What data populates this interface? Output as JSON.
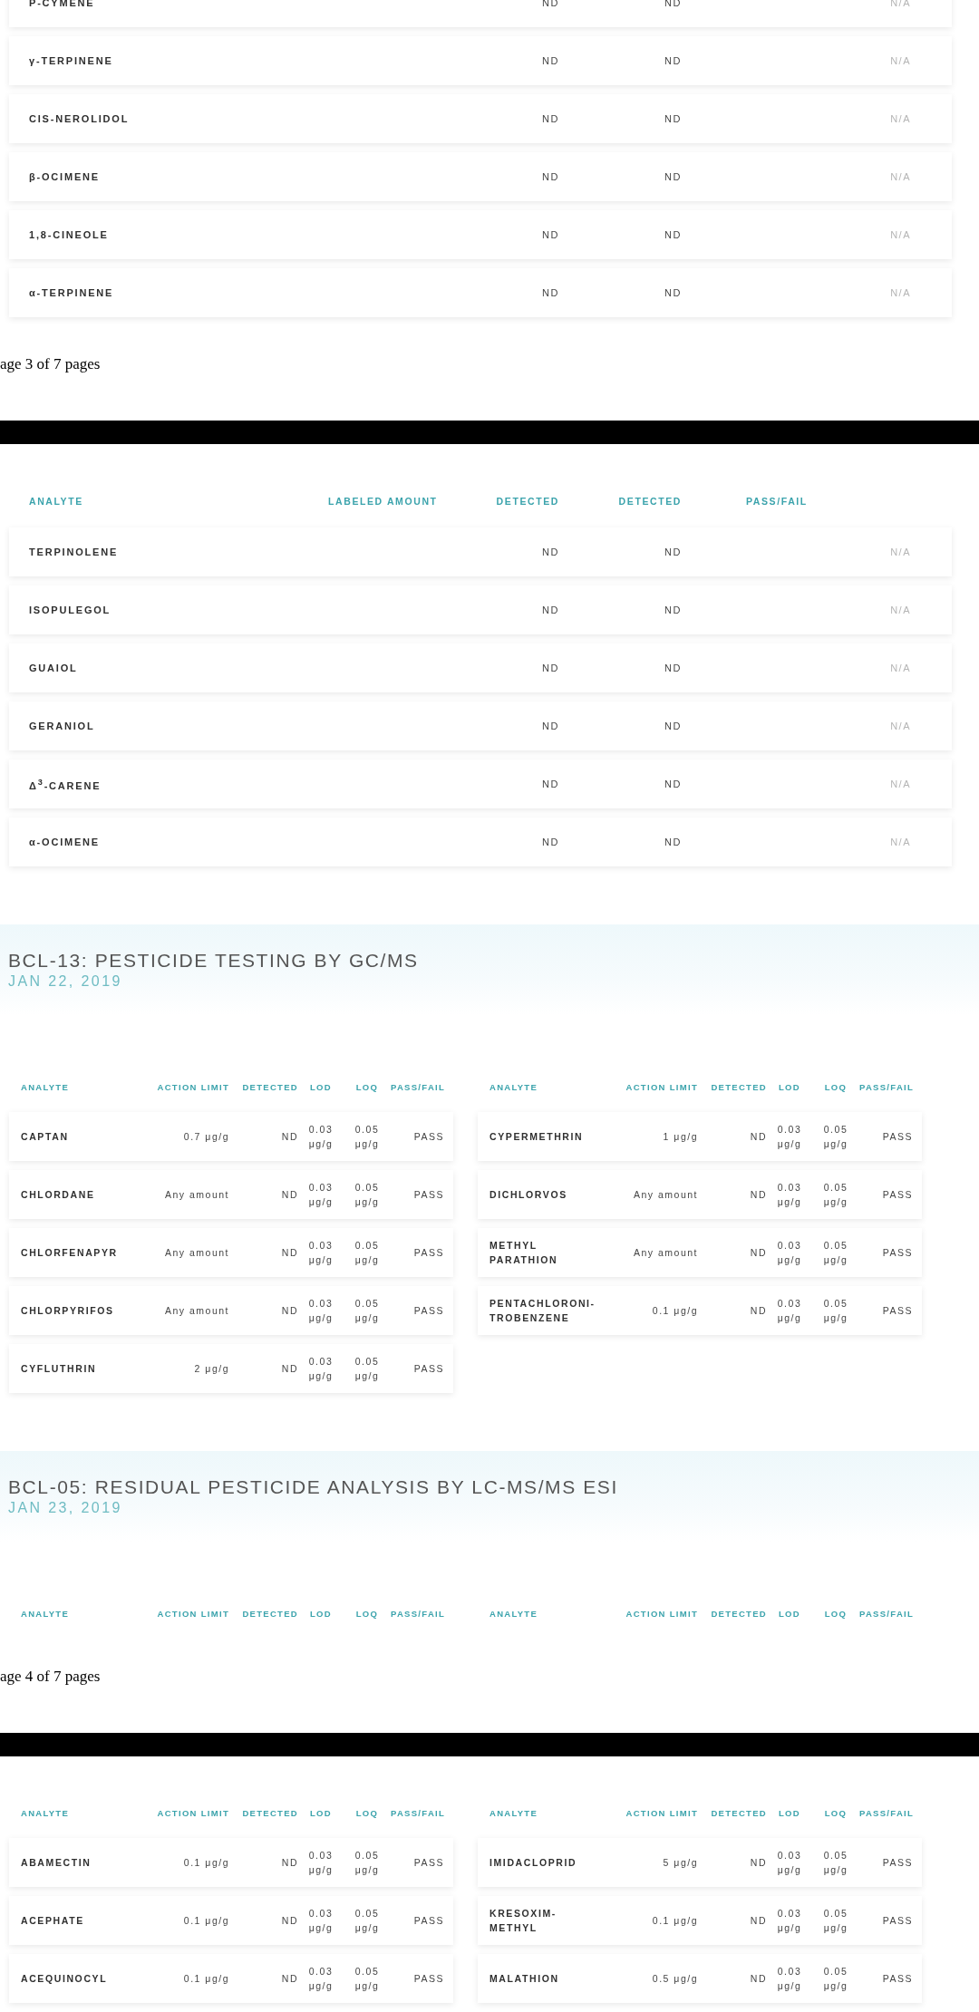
{
  "blocks": [
    {
      "kind": "terpene_table",
      "rows": [
        {
          "analyte": "P-CYMENE",
          "detected_1": "ND",
          "detected_2": "ND",
          "result": "N/A"
        },
        {
          "analyte": "γ-TERPINENE",
          "detected_1": "ND",
          "detected_2": "ND",
          "result": "N/A"
        },
        {
          "analyte": "CIS-NEROLIDOL",
          "detected_1": "ND",
          "detected_2": "ND",
          "result": "N/A"
        },
        {
          "analyte": "β-OCIMENE",
          "detected_1": "ND",
          "detected_2": "ND",
          "result": "N/A"
        },
        {
          "analyte": "1,8-CINEOLE",
          "detected_1": "ND",
          "detected_2": "ND",
          "result": "N/A"
        },
        {
          "analyte": "α-TERPINENE",
          "detected_1": "ND",
          "detected_2": "ND",
          "result": "N/A"
        }
      ]
    },
    {
      "kind": "page_footer",
      "text": "age 3 of 7 pages"
    },
    {
      "kind": "page_break"
    },
    {
      "kind": "terpene_table",
      "columns": [
        "ANALYTE",
        "LABELED AMOUNT",
        "DETECTED",
        "DETECTED",
        "PASS/FAIL"
      ],
      "rows": [
        {
          "analyte": "TERPINOLENE",
          "detected_1": "ND",
          "detected_2": "ND",
          "result": "N/A"
        },
        {
          "analyte": "ISOPULEGOL",
          "detected_1": "ND",
          "detected_2": "ND",
          "result": "N/A"
        },
        {
          "analyte": "GUAIOL",
          "detected_1": "ND",
          "detected_2": "ND",
          "result": "N/A"
        },
        {
          "analyte": "GERANIOL",
          "detected_1": "ND",
          "detected_2": "ND",
          "result": "N/A"
        },
        {
          "analyte": "Δ$^{3}$-CARENE",
          "detected_1": "ND",
          "detected_2": "ND",
          "result": "N/A"
        },
        {
          "analyte": "α-OCIMENE",
          "detected_1": "ND",
          "detected_2": "ND",
          "result": "N/A"
        }
      ]
    },
    {
      "kind": "section_heading",
      "title": "BCL-13: PESTICIDE TESTING BY GC/MS",
      "date": "JAN 22, 2019"
    },
    {
      "kind": "pesticide_tables",
      "tables": [
        {
          "columns": [
            "ANALYTE",
            "ACTION LIMIT",
            "DETECTED",
            "LOD",
            "LOQ",
            "PASS/FAIL"
          ],
          "rows": [
            {
              "analyte": "CAPTAN",
              "action_limit": "0.7 μg/g",
              "detected": "ND",
              "lod": "0.03 μg/g",
              "loq": "0.05 μg/g",
              "result": "PASS"
            },
            {
              "analyte": "CHLORDANE",
              "action_limit": "Any amount",
              "detected": "ND",
              "lod": "0.03 μg/g",
              "loq": "0.05 μg/g",
              "result": "PASS"
            },
            {
              "analyte": "CHLORFENAPYR",
              "action_limit": "Any amount",
              "detected": "ND",
              "lod": "0.03 μg/g",
              "loq": "0.05 μg/g",
              "result": "PASS"
            },
            {
              "analyte": "CHLORPYRIFOS",
              "action_limit": "Any amount",
              "detected": "ND",
              "lod": "0.03 μg/g",
              "loq": "0.05 μg/g",
              "result": "PASS"
            },
            {
              "analyte": "CYFLUTHRIN",
              "action_limit": "2 μg/g",
              "detected": "ND",
              "lod": "0.03 μg/g",
              "loq": "0.05 μg/g",
              "result": "PASS"
            }
          ]
        },
        {
          "columns": [
            "ANALYTE",
            "ACTION LIMIT",
            "DETECTED",
            "LOD",
            "LOQ",
            "PASS/FAIL"
          ],
          "rows": [
            {
              "analyte": "CYPERMETHRIN",
              "action_limit": "1 μg/g",
              "detected": "ND",
              "lod": "0.03 μg/g",
              "loq": "0.05 μg/g",
              "result": "PASS"
            },
            {
              "analyte": "DICHLORVOS",
              "action_limit": "Any amount",
              "detected": "ND",
              "lod": "0.03 μg/g",
              "loq": "0.05 μg/g",
              "result": "PASS"
            },
            {
              "analyte": "METHYL PARATHION",
              "action_limit": "Any amount",
              "detected": "ND",
              "lod": "0.03 μg/g",
              "loq": "0.05 μg/g",
              "result": "PASS"
            },
            {
              "analyte": "PENTACHLORONI-TROBENZENE",
              "action_limit": "0.1 μg/g",
              "detected": "ND",
              "lod": "0.03 μg/g",
              "loq": "0.05 μg/g",
              "result": "PASS"
            }
          ]
        }
      ]
    },
    {
      "kind": "section_heading",
      "title": "BCL-05: RESIDUAL PESTICIDE ANALYSIS BY LC-MS/MS ESI",
      "date": "JAN 23, 2019"
    },
    {
      "kind": "pesticide_tables",
      "tables": [
        {
          "columns": [
            "ANALYTE",
            "ACTION LIMIT",
            "DETECTED",
            "LOD",
            "LOQ",
            "PASS/FAIL"
          ]
        },
        {
          "columns": [
            "ANALYTE",
            "ACTION LIMIT",
            "DETECTED",
            "LOD",
            "LOQ",
            "PASS/FAIL"
          ]
        }
      ]
    },
    {
      "kind": "page_footer",
      "text": "age 4 of 7 pages"
    },
    {
      "kind": "page_break"
    },
    {
      "kind": "pesticide_tables",
      "tables": [
        {
          "columns": [
            "ANALYTE",
            "ACTION LIMIT",
            "DETECTED",
            "LOD",
            "LOQ",
            "PASS/FAIL"
          ],
          "rows": [
            {
              "analyte": "ABAMECTIN",
              "action_limit": "0.1 μg/g",
              "detected": "ND",
              "lod": "0.03 μg/g",
              "loq": "0.05 μg/g",
              "result": "PASS"
            },
            {
              "analyte": "ACEPHATE",
              "action_limit": "0.1 μg/g",
              "detected": "ND",
              "lod": "0.03 μg/g",
              "loq": "0.05 μg/g",
              "result": "PASS"
            },
            {
              "analyte": "ACEQUINOCYL",
              "action_limit": "0.1 μg/g",
              "detected": "ND",
              "lod": "0.03 μg/g",
              "loq": "0.05 μg/g",
              "result": "PASS"
            }
          ]
        },
        {
          "columns": [
            "ANALYTE",
            "ACTION LIMIT",
            "DETECTED",
            "LOD",
            "LOQ",
            "PASS/FAIL"
          ],
          "rows": [
            {
              "analyte": "IMIDACLOPRID",
              "action_limit": "5 μg/g",
              "detected": "ND",
              "lod": "0.03 μg/g",
              "loq": "0.05 μg/g",
              "result": "PASS"
            },
            {
              "analyte": "KRESOXIM-METHYL",
              "action_limit": "0.1 μg/g",
              "detected": "ND",
              "lod": "0.03 μg/g",
              "loq": "0.05 μg/g",
              "result": "PASS"
            },
            {
              "analyte": "MALATHION",
              "action_limit": "0.5 μg/g",
              "detected": "ND",
              "lod": "0.03 μg/g",
              "loq": "0.05 μg/g",
              "result": "PASS"
            }
          ]
        }
      ]
    }
  ]
}
